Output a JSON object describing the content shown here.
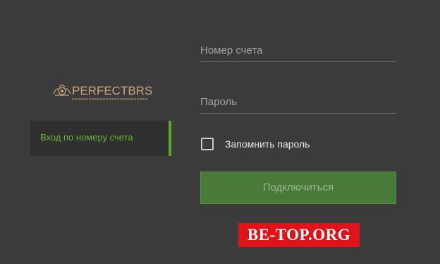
{
  "brand": {
    "logo_text": "PERFECTBRS",
    "logo_gold": "#c7a77a"
  },
  "sidebar": {
    "items": [
      {
        "label": "Вход по номеру счета",
        "active": true
      }
    ],
    "accent": "#5ea530"
  },
  "form": {
    "account_placeholder": "Номер счета",
    "account_value": "",
    "password_placeholder": "Пароль",
    "password_value": "",
    "remember_label": "Запомнить пароль",
    "remember_checked": false,
    "connect_label": "Подключиться",
    "connect_color": "#4a7a39"
  },
  "watermark": {
    "text": "BE-TOP.ORG",
    "color": "#e0131b"
  }
}
